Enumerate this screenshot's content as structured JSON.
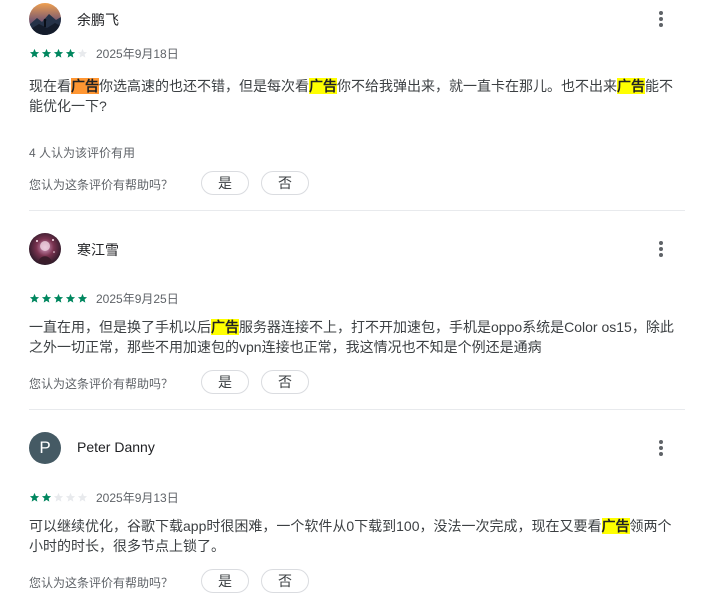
{
  "colors": {
    "star_filled": "#01875f",
    "star_empty": "#e8eaed",
    "highlight": "#ffff00",
    "highlight_active": "#ff9632",
    "avatar_letter_bg": "#455a64"
  },
  "helpful_prompt": "您认为这条评价有帮助吗？",
  "yes_label": "是",
  "no_label": "否",
  "more_icon": "more-vert-icon",
  "reviews": [
    {
      "author": "余鹏飞",
      "avatar": "photo-avatar-mountain",
      "rating": 4,
      "max_rating": 5,
      "date": "2025年9月18日",
      "text_segments": [
        {
          "text": "现在看"
        },
        {
          "text": "广告",
          "highlight": "active"
        },
        {
          "text": "你选高速的也还不错，但是每次看"
        },
        {
          "text": "广告",
          "highlight": "match"
        },
        {
          "text": "你不给我弹出来，就一直卡在那儿。也不出来"
        },
        {
          "text": "广告",
          "highlight": "match"
        },
        {
          "text": "能不能优化一下?"
        }
      ],
      "useful_count": "4 人认为该评价有用"
    },
    {
      "author": "寒江雪",
      "avatar": "photo-avatar-dark",
      "rating": 5,
      "max_rating": 5,
      "date": "2025年9月25日",
      "text_segments": [
        {
          "text": "一直在用，但是换了手机以后"
        },
        {
          "text": "广告",
          "highlight": "match"
        },
        {
          "text": "服务器连接不上，打不开加速包，手机是oppo系统是Color os15，除此之外一切正常，那些不用加速包的vpn连接也正常，我这情况也不知是个例还是通病"
        }
      ]
    },
    {
      "author": "Peter Danny",
      "avatar_letter": "P",
      "rating": 2,
      "max_rating": 5,
      "date": "2025年9月13日",
      "text_segments": [
        {
          "text": "可以继续优化，谷歌下载app时很困难，一个软件从0下载到100，没法一次完成，现在又要看"
        },
        {
          "text": "广告",
          "highlight": "match"
        },
        {
          "text": "领两个小时的时长，很多节点上锁了。"
        }
      ]
    }
  ]
}
